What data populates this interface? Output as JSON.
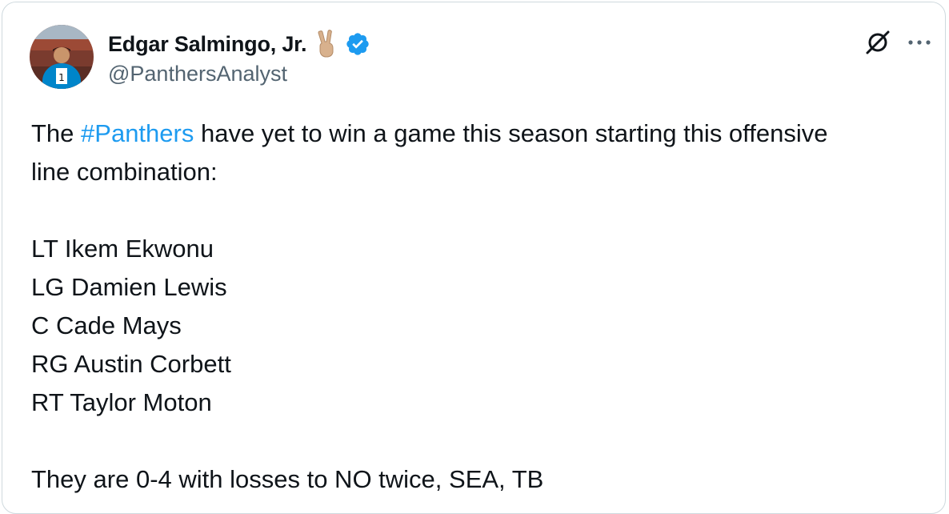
{
  "tweet": {
    "author": {
      "name": "Edgar Salmingo, Jr.",
      "handle": "@PanthersAnalyst",
      "emoji_icon": "victory-hand-icon",
      "verified_icon": "verified-badge-icon",
      "verified_color": "#1d9bf0"
    },
    "header_actions": {
      "grok_icon": "grok-icon",
      "more_icon": "more-horizontal-icon"
    },
    "text": {
      "line1_before": "The ",
      "hashtag": "#Panthers",
      "line1_after": " have yet to win a game this season starting this offensive",
      "line2": "line combination:",
      "lineup": [
        "LT Ikem Ekwonu",
        "LG Damien Lewis",
        "C Cade Mays",
        "RG Austin Corbett",
        "RT Taylor Moton"
      ],
      "closing": "They are 0-4 with losses to NO twice, SEA, TB"
    },
    "colors": {
      "text": "#0f1419",
      "secondary": "#536471",
      "link": "#1d9bf0",
      "border": "#cfd9de"
    }
  }
}
